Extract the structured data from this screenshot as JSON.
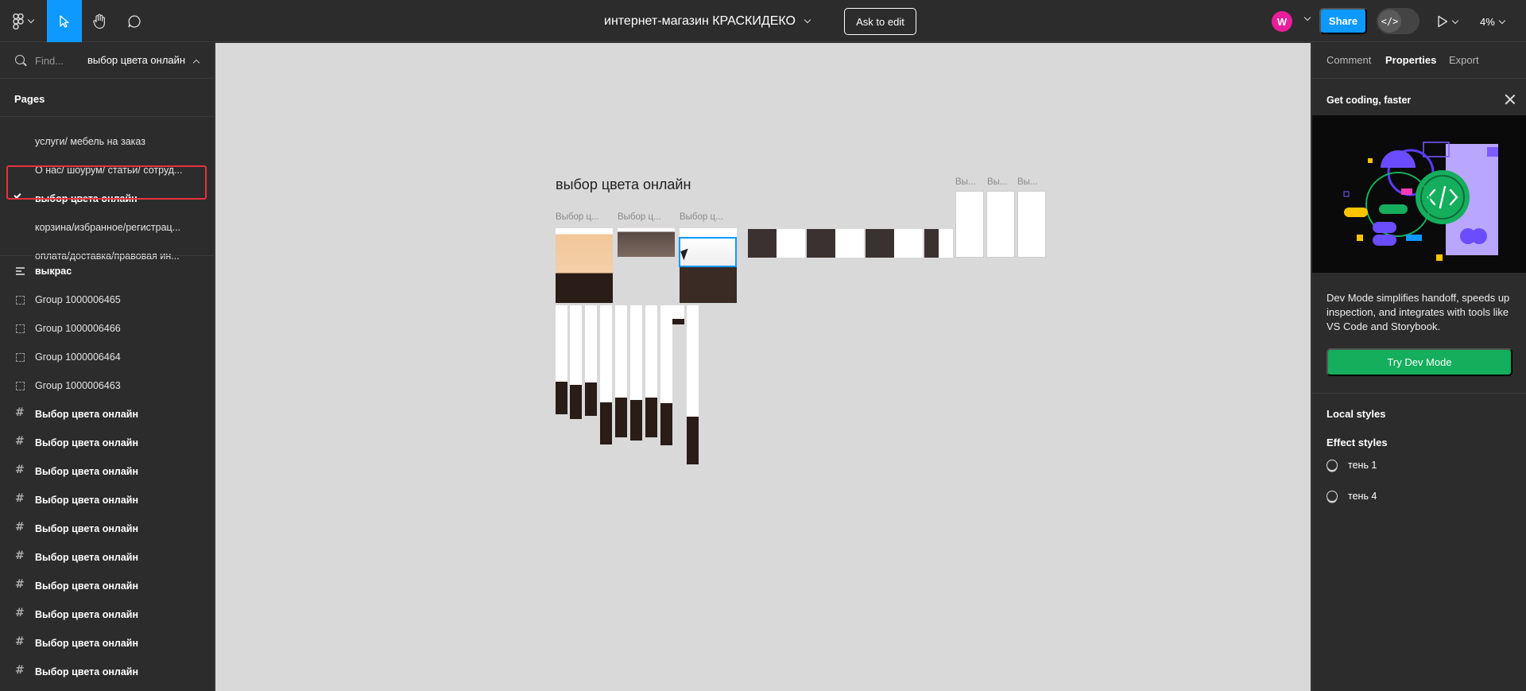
{
  "topbar": {
    "doc_title": "интернет-магазин КРАСКИДЕКО",
    "ask_to_edit": "Ask to edit",
    "avatar_initial": "W",
    "share": "Share",
    "dev_toggle_glyph": "</>",
    "zoom": "4%",
    "active_tool": "move"
  },
  "left": {
    "find_placeholder": "Find...",
    "current_page": "выбор цвета онлайн",
    "pages_header": "Pages",
    "pages": [
      {
        "label": "услуги/ мебель на заказ",
        "active": false
      },
      {
        "label": "О нас/ шоурум/ статьи/ сотруд...",
        "active": false
      },
      {
        "label": "выбор цвета онлайн",
        "active": true
      },
      {
        "label": "корзина/избранное/регистрац...",
        "active": false
      },
      {
        "label": "оплата/доставка/правовая ин...",
        "active": false
      }
    ],
    "layers": [
      {
        "label": "выкрас",
        "icon": "text-lines-icon",
        "bold": true
      },
      {
        "label": "Group 1000006465",
        "icon": "group-icon",
        "bold": false
      },
      {
        "label": "Group 1000006466",
        "icon": "group-icon",
        "bold": false
      },
      {
        "label": "Group 1000006464",
        "icon": "group-icon",
        "bold": false
      },
      {
        "label": "Group 1000006463",
        "icon": "group-icon",
        "bold": false
      },
      {
        "label": "Выбор цвета онлайн",
        "icon": "frame-icon",
        "bold": true
      },
      {
        "label": "Выбор цвета онлайн",
        "icon": "frame-icon",
        "bold": true
      },
      {
        "label": "Выбор цвета онлайн",
        "icon": "frame-icon",
        "bold": true
      },
      {
        "label": "Выбор цвета онлайн",
        "icon": "frame-icon",
        "bold": true
      },
      {
        "label": "Выбор цвета онлайн",
        "icon": "frame-icon",
        "bold": true
      },
      {
        "label": "Выбор цвета онлайн",
        "icon": "frame-icon",
        "bold": true
      },
      {
        "label": "Выбор цвета онлайн",
        "icon": "frame-icon",
        "bold": true
      },
      {
        "label": "Выбор цвета онлайн",
        "icon": "frame-icon",
        "bold": true
      },
      {
        "label": "Выбор цвета онлайн",
        "icon": "frame-icon",
        "bold": true
      },
      {
        "label": "Выбор цвета онлайн",
        "icon": "frame-icon",
        "bold": true
      }
    ]
  },
  "canvas": {
    "section_title": "выбор цвета онлайн",
    "frame_labels": [
      "Выбор ц...",
      "Выбор ц...",
      "Выбор ц...",
      "Вы...",
      "Вы...",
      "Вы..."
    ],
    "help": "?"
  },
  "right": {
    "tabs": [
      "Comment",
      "Properties",
      "Export"
    ],
    "active_tab": "Properties",
    "promo_title": "Get coding, faster",
    "promo_text": "Dev Mode simplifies handoff, speeds up inspection, and integrates with tools like VS Code and Storybook.",
    "promo_button": "Try Dev Mode",
    "local_styles": "Local styles",
    "effect_styles": "Effect styles",
    "styles": [
      "тень 1",
      "тень 4"
    ]
  },
  "colors": {
    "accent": "#0d99ff",
    "dev_green": "#14ae5c",
    "active_outline": "#e5323b",
    "panel_bg": "#2c2c2c",
    "canvas_bg": "#d9d9d9"
  }
}
